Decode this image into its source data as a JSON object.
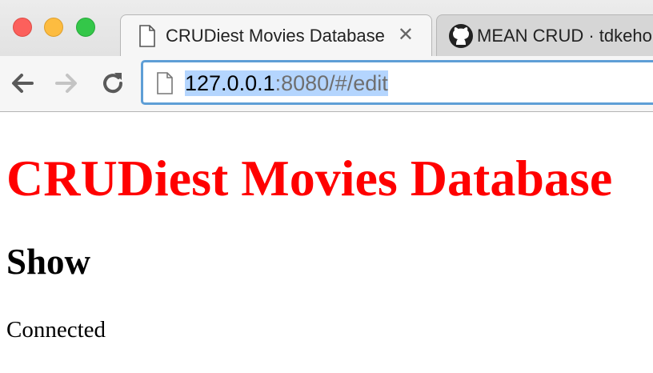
{
  "browser": {
    "tabs": [
      {
        "title": "CRUDiest Movies Database",
        "icon": "page-icon",
        "active": true,
        "close_label": "✕"
      },
      {
        "title": "MEAN CRUD · tdkeho",
        "icon": "github-icon",
        "active": false
      }
    ],
    "address_bar": {
      "url_host": "127.0.0.1",
      "url_rest": ":8080/#/edit",
      "icon": "page-icon"
    },
    "nav": {
      "back": "back-arrow-icon",
      "forward": "forward-arrow-icon",
      "reload": "reload-icon"
    }
  },
  "page": {
    "title": "CRUDiest Movies Database",
    "section_heading": "Show",
    "status_text": "Connected"
  },
  "colors": {
    "title_red": "#ff0000",
    "url_selection": "#b4d5fe",
    "omnibox_focus": "#5e9ed6"
  }
}
